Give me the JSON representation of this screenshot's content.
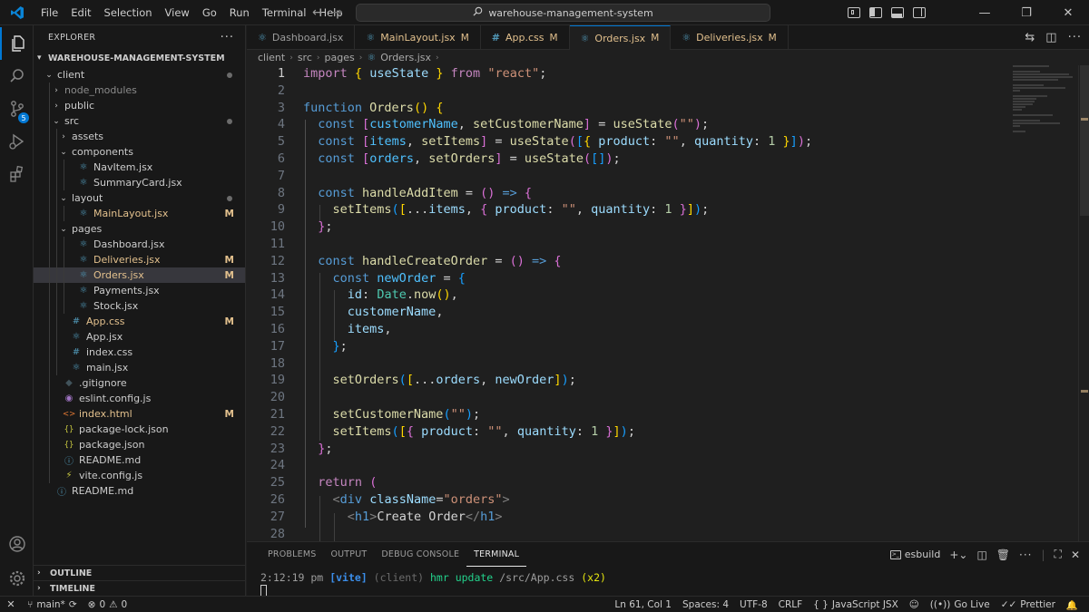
{
  "titlebar": {
    "menu": [
      "File",
      "Edit",
      "Selection",
      "View",
      "Go",
      "Run",
      "Terminal",
      "Help"
    ],
    "search_text": "warehouse-management-system"
  },
  "activity": {
    "scm_badge": "5"
  },
  "explorer": {
    "header": "EXPLORER",
    "root": "WAREHOUSE-MANAGEMENT-SYSTEM",
    "items": [
      {
        "label": "client",
        "type": "folder-open",
        "depth": 1,
        "dot": true
      },
      {
        "label": "node_modules",
        "type": "folder",
        "depth": 2,
        "dim": true
      },
      {
        "label": "public",
        "type": "folder",
        "depth": 2
      },
      {
        "label": "src",
        "type": "folder-open",
        "depth": 2,
        "dot": true
      },
      {
        "label": "assets",
        "type": "folder",
        "depth": 3
      },
      {
        "label": "components",
        "type": "folder-open",
        "depth": 3
      },
      {
        "label": "NavItem.jsx",
        "type": "react",
        "depth": 4
      },
      {
        "label": "SummaryCard.jsx",
        "type": "react",
        "depth": 4
      },
      {
        "label": "layout",
        "type": "folder-open",
        "depth": 3,
        "dot": true
      },
      {
        "label": "MainLayout.jsx",
        "type": "react",
        "depth": 4,
        "status": "M"
      },
      {
        "label": "pages",
        "type": "folder-open",
        "depth": 3
      },
      {
        "label": "Dashboard.jsx",
        "type": "react",
        "depth": 4
      },
      {
        "label": "Deliveries.jsx",
        "type": "react",
        "depth": 4,
        "status": "M"
      },
      {
        "label": "Orders.jsx",
        "type": "react",
        "depth": 4,
        "status": "M",
        "selected": true
      },
      {
        "label": "Payments.jsx",
        "type": "react",
        "depth": 4
      },
      {
        "label": "Stock.jsx",
        "type": "react",
        "depth": 4
      },
      {
        "label": "App.css",
        "type": "css",
        "depth": 3,
        "status": "M"
      },
      {
        "label": "App.jsx",
        "type": "react",
        "depth": 3
      },
      {
        "label": "index.css",
        "type": "css",
        "depth": 3
      },
      {
        "label": "main.jsx",
        "type": "react",
        "depth": 3
      },
      {
        "label": ".gitignore",
        "type": "git",
        "depth": 2
      },
      {
        "label": "eslint.config.js",
        "type": "eslint",
        "depth": 2
      },
      {
        "label": "index.html",
        "type": "html",
        "depth": 2,
        "status": "M"
      },
      {
        "label": "package-lock.json",
        "type": "json",
        "depth": 2
      },
      {
        "label": "package.json",
        "type": "json",
        "depth": 2
      },
      {
        "label": "README.md",
        "type": "info",
        "depth": 2
      },
      {
        "label": "vite.config.js",
        "type": "vite",
        "depth": 2
      },
      {
        "label": "README.md",
        "type": "info",
        "depth": 1
      }
    ],
    "outline": "OUTLINE",
    "timeline": "TIMELINE"
  },
  "tabs": [
    {
      "label": "Dashboard.jsx",
      "icon": "react",
      "status": ""
    },
    {
      "label": "MainLayout.jsx",
      "icon": "react",
      "status": "M"
    },
    {
      "label": "App.css",
      "icon": "css",
      "status": "M"
    },
    {
      "label": "Orders.jsx",
      "icon": "react",
      "status": "M",
      "active": true
    },
    {
      "label": "Deliveries.jsx",
      "icon": "react",
      "status": "M"
    }
  ],
  "breadcrumb": [
    "client",
    "src",
    "pages",
    "Orders.jsx"
  ],
  "editor": {
    "line_numbers": [
      "1",
      "2",
      "3",
      "4",
      "5",
      "6",
      "7",
      "8",
      "9",
      "10",
      "11",
      "12",
      "13",
      "14",
      "15",
      "16",
      "17",
      "18",
      "19",
      "20",
      "21",
      "22",
      "23",
      "24",
      "25",
      "26",
      "27",
      "28"
    ]
  },
  "panel": {
    "tabs": [
      "PROBLEMS",
      "OUTPUT",
      "DEBUG CONSOLE",
      "TERMINAL"
    ],
    "active_tab": "TERMINAL",
    "terminal_name": "esbuild",
    "terminal_time": "2:12:19 pm",
    "terminal_tag": "[vite]",
    "terminal_client": "(client)",
    "terminal_msg": "hmr update",
    "terminal_path": "/src/App.css",
    "terminal_count": "(x2)"
  },
  "status": {
    "branch": "main*",
    "errors": "0",
    "warnings": "0",
    "position": "Ln 61, Col 1",
    "spaces": "Spaces: 4",
    "encoding": "UTF-8",
    "eol": "CRLF",
    "language": "JavaScript JSX",
    "golive": "Go Live",
    "prettier": "Prettier"
  },
  "colors": {
    "accent": "#0078d4",
    "modified": "#e2c08d",
    "background": "#1f1f1f",
    "sidebar": "#181818"
  }
}
